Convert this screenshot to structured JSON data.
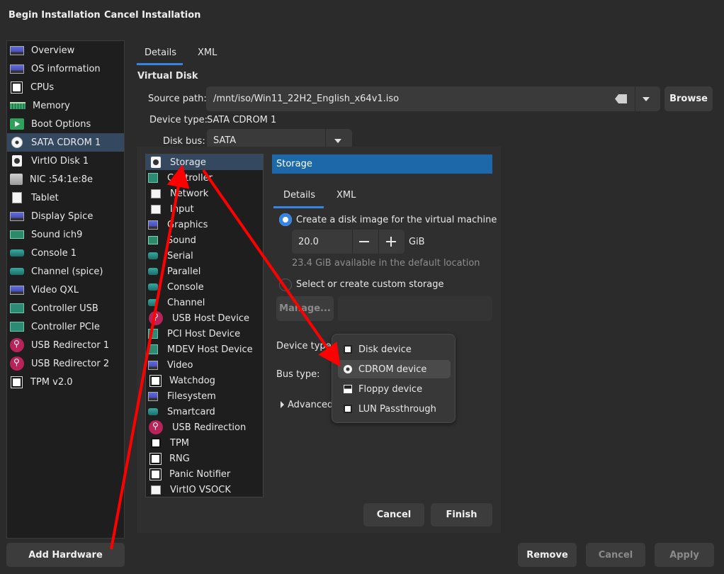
{
  "header": {
    "begin": "Begin Installation",
    "cancel": "Cancel Installation"
  },
  "devices": [
    {
      "label": "Overview",
      "icon": "monitor-icon"
    },
    {
      "label": "OS information",
      "icon": "monitor-icon"
    },
    {
      "label": "CPUs",
      "icon": "chip-icon"
    },
    {
      "label": "Memory",
      "icon": "memory-icon"
    },
    {
      "label": "Boot Options",
      "icon": "boot-icon"
    },
    {
      "label": "SATA CDROM 1",
      "icon": "cdrom-icon"
    },
    {
      "label": "VirtIO Disk 1",
      "icon": "disk-icon"
    },
    {
      "label": "NIC :54:1e:8e",
      "icon": "nic-icon"
    },
    {
      "label": "Tablet",
      "icon": "tablet-icon"
    },
    {
      "label": "Display Spice",
      "icon": "display-icon"
    },
    {
      "label": "Sound ich9",
      "icon": "sound-icon"
    },
    {
      "label": "Console 1",
      "icon": "serial-icon"
    },
    {
      "label": "Channel (spice)",
      "icon": "serial-icon"
    },
    {
      "label": "Video QXL",
      "icon": "display-icon"
    },
    {
      "label": "Controller USB",
      "icon": "controller-icon"
    },
    {
      "label": "Controller PCIe",
      "icon": "controller-icon"
    },
    {
      "label": "USB Redirector 1",
      "icon": "usb-icon"
    },
    {
      "label": "USB Redirector 2",
      "icon": "usb-icon"
    },
    {
      "label": "TPM v2.0",
      "icon": "chip-icon"
    }
  ],
  "tabs": {
    "details": "Details",
    "xml": "XML"
  },
  "virtual_disk": {
    "title": "Virtual Disk",
    "source_label": "Source path:",
    "source_value": "/mnt/iso/Win11_22H2_English_x64v1.iso",
    "browse": "Browse",
    "device_type_label": "Device type:",
    "device_type_value": "SATA CDROM 1",
    "disk_bus_label": "Disk bus:",
    "disk_bus_value": "SATA"
  },
  "hw_types": [
    "Storage",
    "Controller",
    "Network",
    "Input",
    "Graphics",
    "Sound",
    "Serial",
    "Parallel",
    "Console",
    "Channel",
    "USB Host Device",
    "PCI Host Device",
    "MDEV Host Device",
    "Video",
    "Watchdog",
    "Filesystem",
    "Smartcard",
    "USB Redirection",
    "TPM",
    "RNG",
    "Panic Notifier",
    "VirtIO VSOCK"
  ],
  "storage": {
    "title": "Storage",
    "opt_create": "Create a disk image for the virtual machine",
    "size": "20.0",
    "unit": "GiB",
    "available": "23.4 GiB available in the default location",
    "opt_custom": "Select or create custom storage",
    "manage": "Manage...",
    "device_type_label": "Device type",
    "bus_type_label": "Bus type:",
    "advanced": "Advanced"
  },
  "popover": [
    "Disk device",
    "CDROM device",
    "Floppy device",
    "LUN Passthrough"
  ],
  "dialog_buttons": {
    "cancel": "Cancel",
    "finish": "Finish"
  },
  "footer": {
    "add": "Add Hardware",
    "remove": "Remove",
    "cancel": "Cancel",
    "apply": "Apply"
  },
  "colors": {
    "accent": "#3584e4",
    "selection": "#344860",
    "storage_header": "#1c68a8",
    "annotation_arrow": "#ff0000"
  }
}
